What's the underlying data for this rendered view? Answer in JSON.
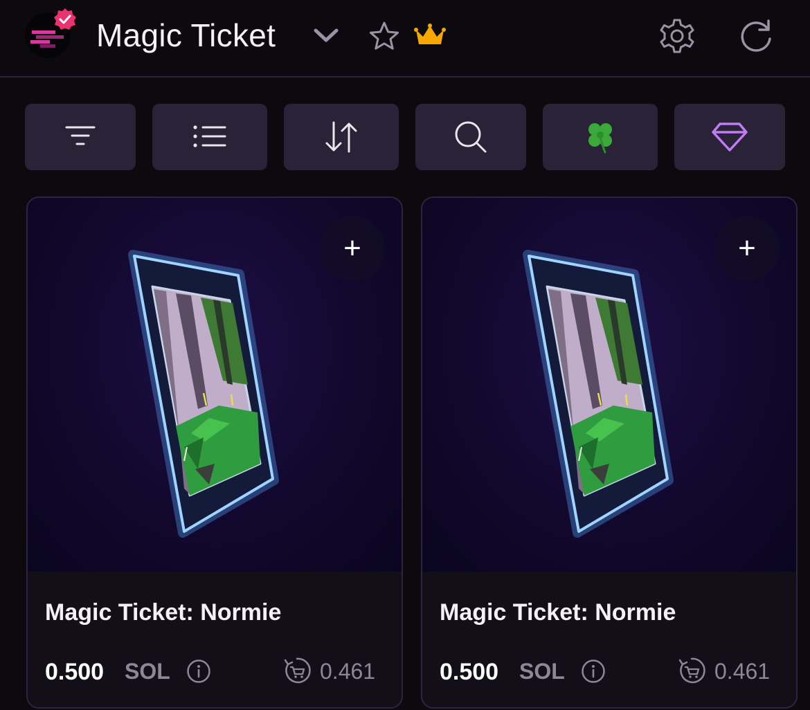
{
  "header": {
    "title": "Magic Ticket",
    "icons": [
      "chevron-down-icon",
      "star-icon",
      "crown-icon",
      "gear-icon",
      "refresh-icon"
    ],
    "colors": {
      "crown": "#f6a800",
      "verified_badge": "#e8336f"
    }
  },
  "toolbar": {
    "buttons": [
      {
        "icon": "filter-icon"
      },
      {
        "icon": "list-icon"
      },
      {
        "icon": "sort-icon"
      },
      {
        "icon": "search-icon"
      },
      {
        "icon": "four-leaf-clover-icon",
        "glyph": "🍀"
      },
      {
        "icon": "diamond-icon",
        "color": "#c07cf2"
      }
    ]
  },
  "cards": [
    {
      "name": "Magic Ticket: Normie",
      "price": "0.500",
      "currency": "SOL",
      "last_sale": "0.461",
      "add_label": "+"
    },
    {
      "name": "Magic Ticket: Normie",
      "price": "0.500",
      "currency": "SOL",
      "last_sale": "0.461",
      "add_label": "+"
    }
  ]
}
